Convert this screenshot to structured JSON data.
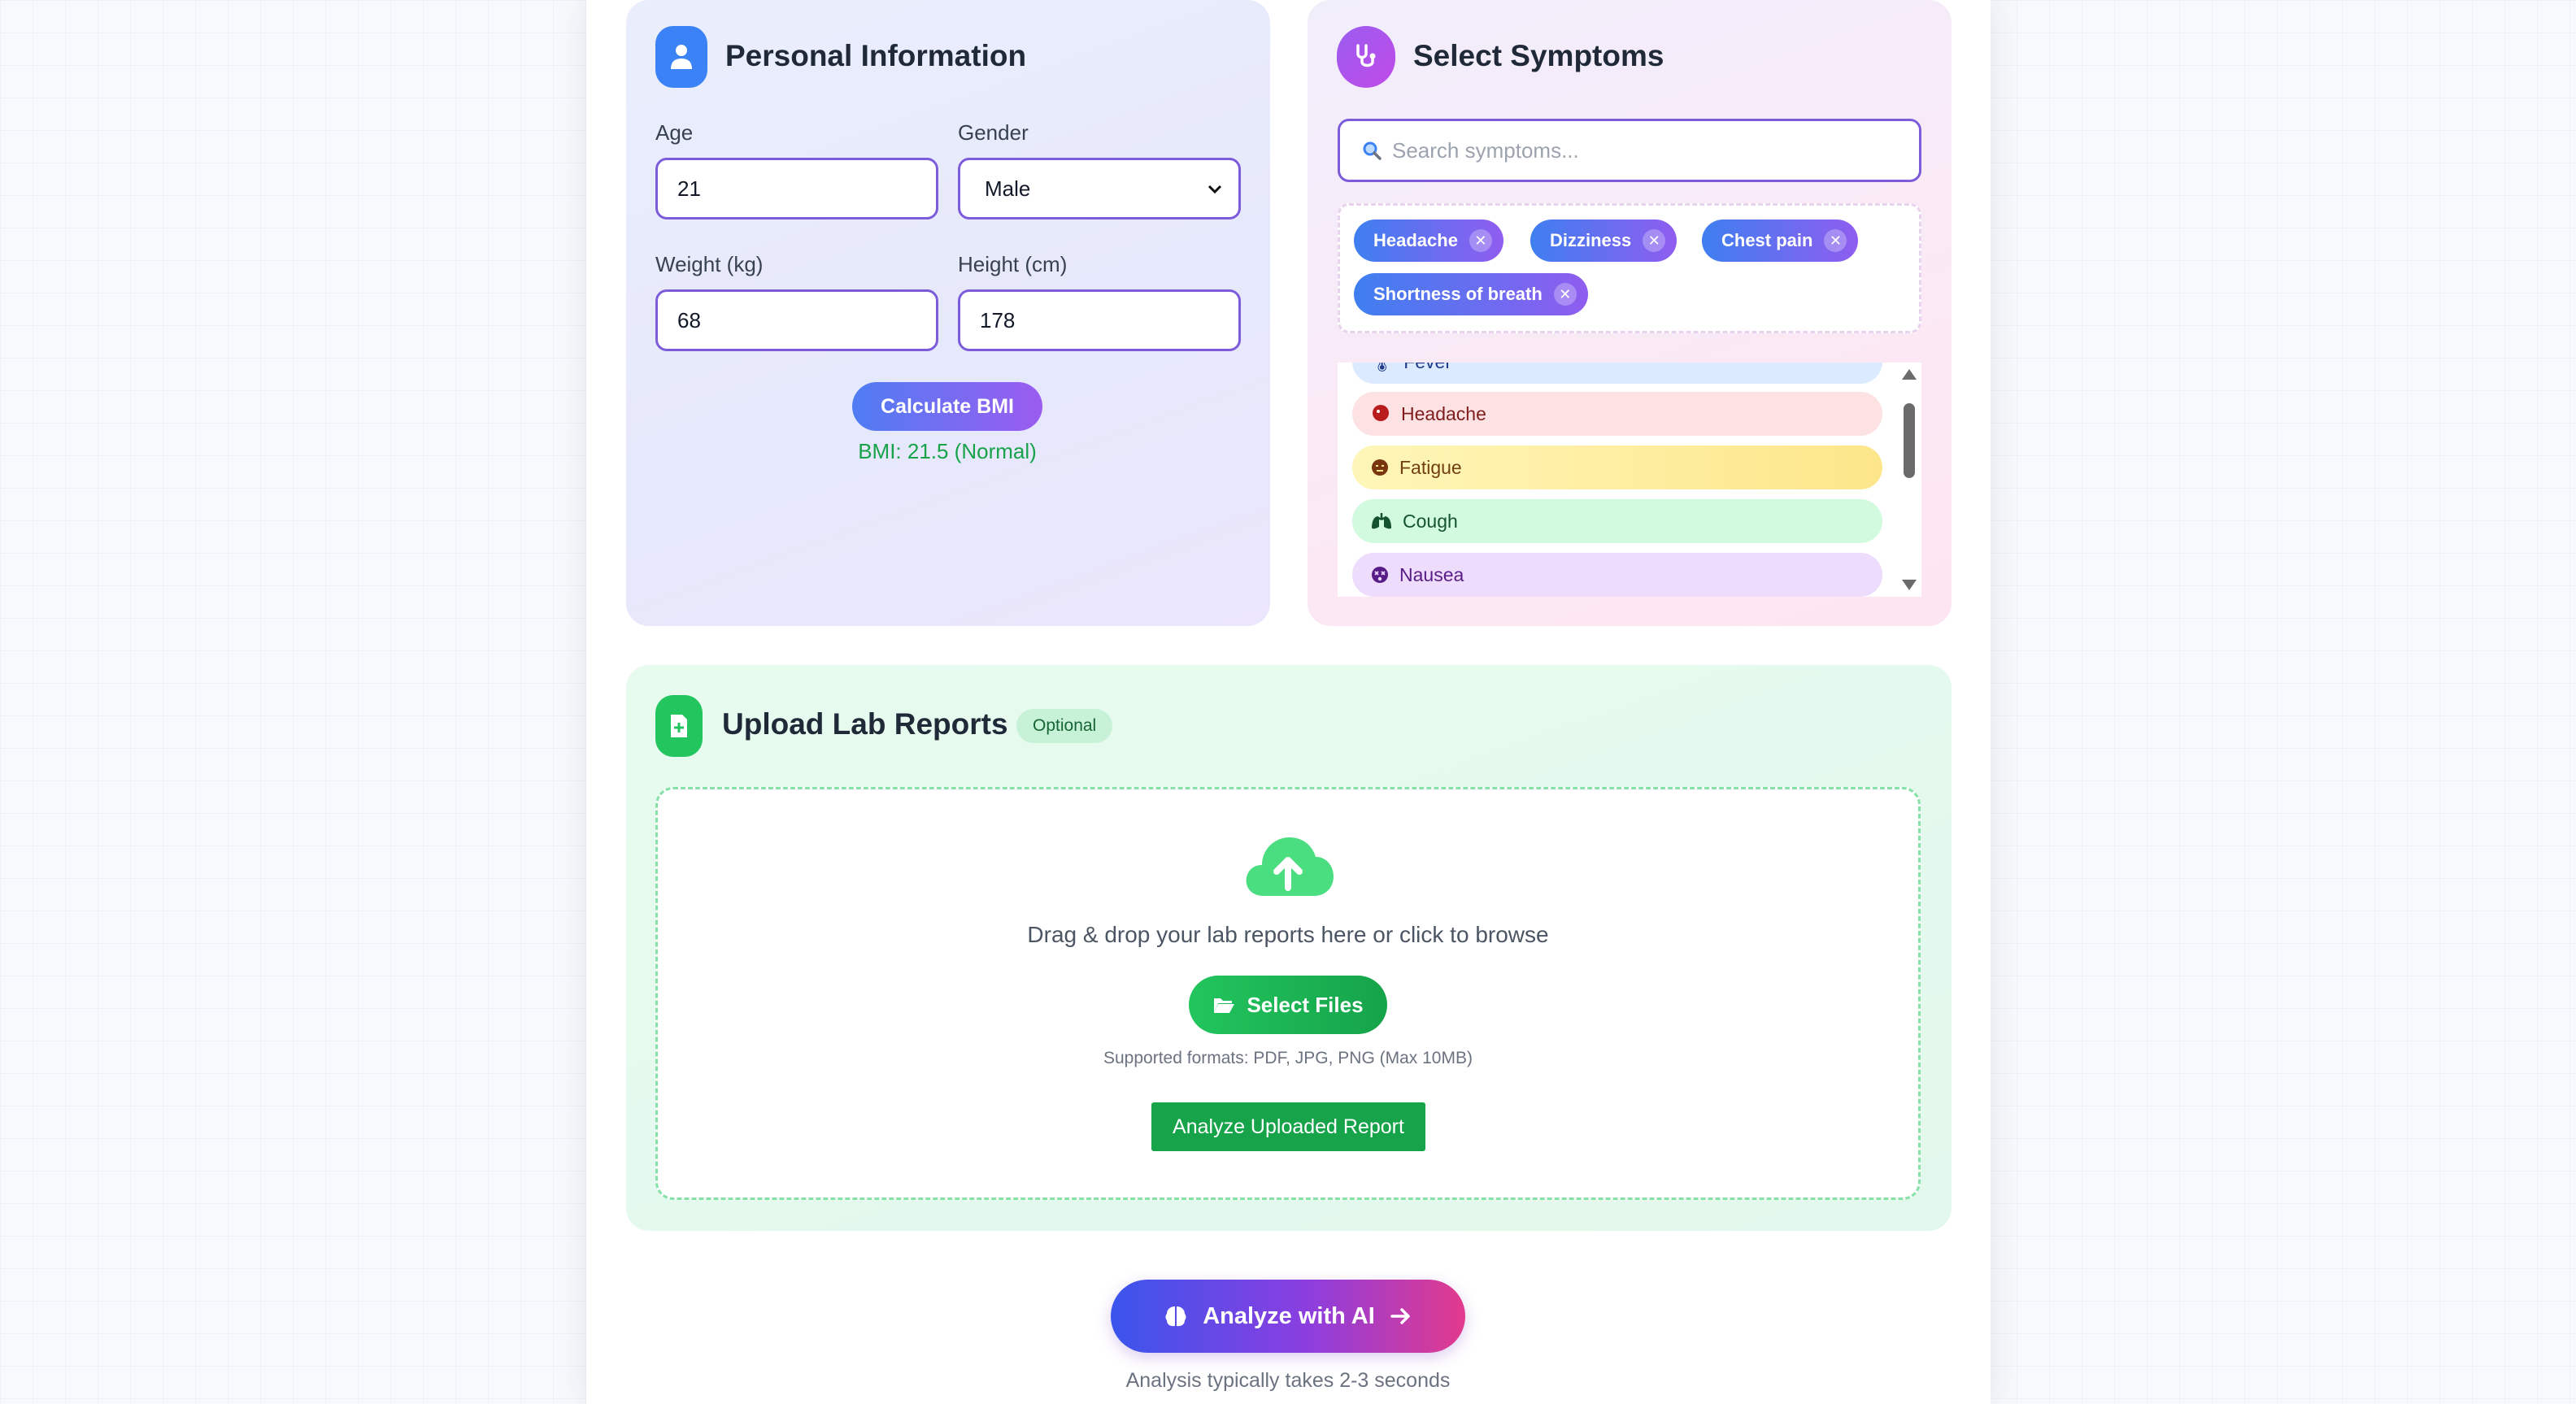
{
  "personal": {
    "title": "Personal Information",
    "age_label": "Age",
    "age_value": "21",
    "gender_label": "Gender",
    "gender_value": "Male",
    "weight_label": "Weight (kg)",
    "weight_value": "68",
    "height_label": "Height (cm)",
    "height_value": "178",
    "bmi_button": "Calculate BMI",
    "bmi_result": "BMI: 21.5 (Normal)"
  },
  "symptoms": {
    "title": "Select Symptoms",
    "search_placeholder": "Search symptoms...",
    "selected": [
      {
        "label": "Headache"
      },
      {
        "label": "Dizziness"
      },
      {
        "label": "Chest pain"
      },
      {
        "label": "Shortness of breath"
      }
    ],
    "list": [
      {
        "label": "Fever",
        "icon": "thermometer-icon",
        "bg": "#dbeafe",
        "fg": "#1e3a8a"
      },
      {
        "label": "Headache",
        "icon": "head-icon",
        "bg": "#fde2e4",
        "fg": "#7f1d1d"
      },
      {
        "label": "Fatigue",
        "icon": "tired-face-icon",
        "bg": "#fef3a8",
        "fg": "#713f12"
      },
      {
        "label": "Cough",
        "icon": "lungs-icon",
        "bg": "#d1fadf",
        "fg": "#14532d"
      },
      {
        "label": "Nausea",
        "icon": "dizzy-face-icon",
        "bg": "#eedcfc",
        "fg": "#581c87"
      }
    ]
  },
  "upload": {
    "title": "Upload Lab Reports",
    "badge": "Optional",
    "drop_text": "Drag & drop your lab reports here or click to browse",
    "select_button": "Select Files",
    "formats": "Supported formats: PDF, JPG, PNG (Max 10MB)",
    "analyze_report_button": "Analyze Uploaded Report"
  },
  "footer": {
    "analyze_button": "Analyze with AI",
    "hint": "Analysis typically takes 2-3 seconds"
  }
}
